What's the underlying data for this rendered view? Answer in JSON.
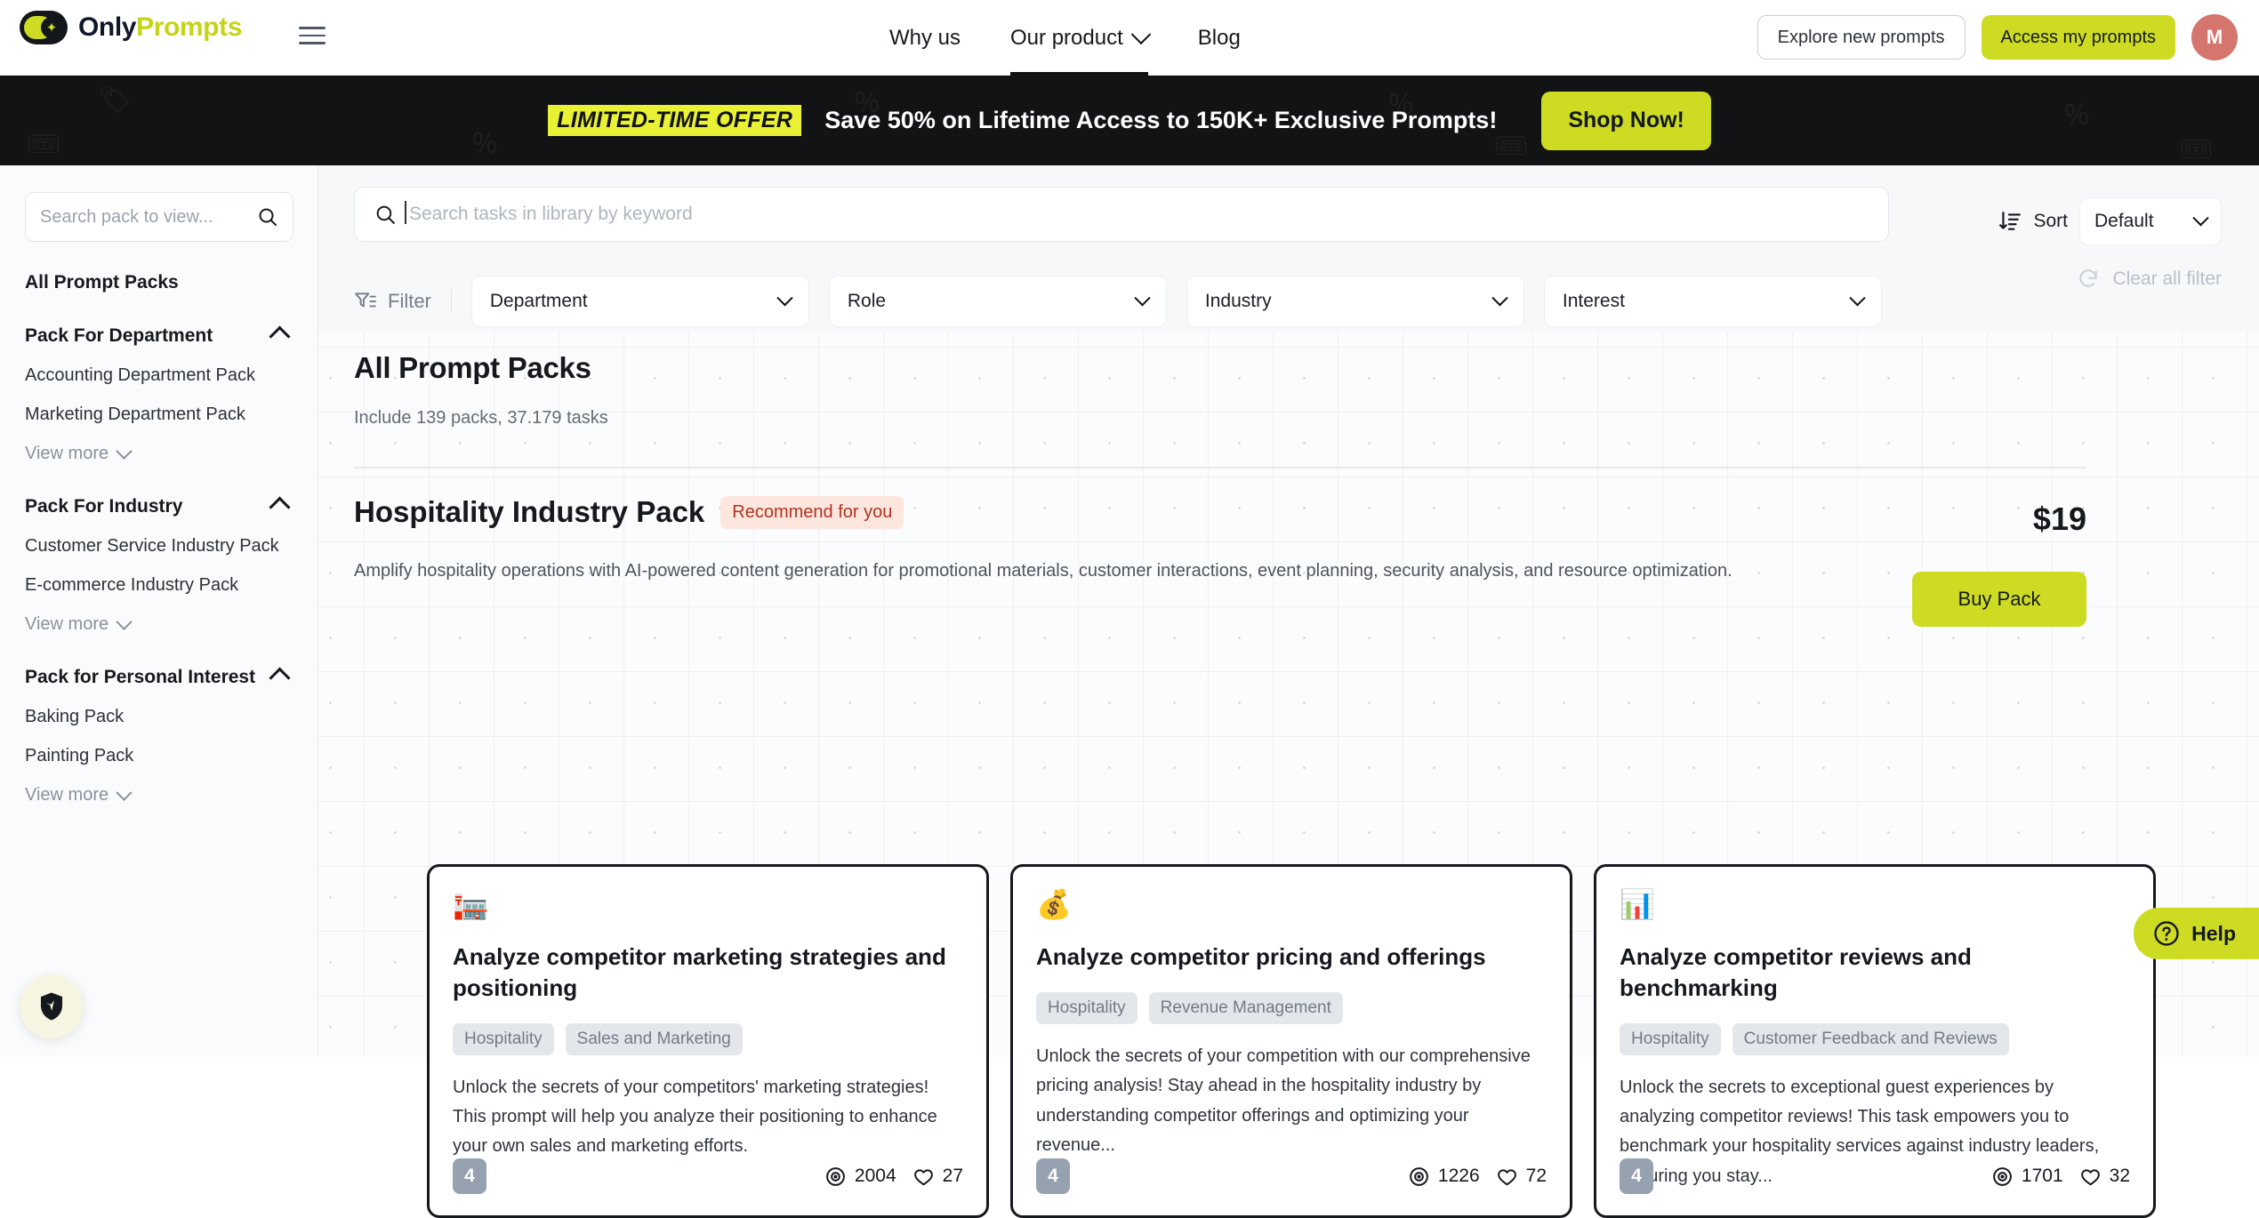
{
  "header": {
    "logo": {
      "name_part1": "Only",
      "name_part2": "Prompts",
      "mark": "toggle-sparkle-logo"
    },
    "menu_icon": "hamburger-icon",
    "nav": [
      {
        "label": "Why us",
        "active": false,
        "has_caret": false
      },
      {
        "label": "Our product",
        "active": true,
        "has_caret": true
      },
      {
        "label": "Blog",
        "active": false,
        "has_caret": false
      }
    ],
    "explore_label": "Explore new prompts",
    "access_label": "Access my prompts",
    "avatar_initial": "M",
    "avatar_color": "#d4756e"
  },
  "promo": {
    "tag": "LIMITED-TIME OFFER",
    "text": "Save 50% on Lifetime Access to 150K+ Exclusive Prompts!",
    "button": "Shop Now!",
    "bg": "#121315",
    "accent": "#cddc22",
    "tag_bg": "#e9f135"
  },
  "sidebar": {
    "search_placeholder": "Search pack to view...",
    "all_packs_label": "All Prompt Packs",
    "view_more_label": "View more",
    "groups": [
      {
        "title": "Pack For Department",
        "items": [
          "Accounting Department Pack",
          "Marketing Department Pack"
        ]
      },
      {
        "title": "Pack For Industry",
        "items": [
          "Customer Service Industry Pack",
          "E-commerce Industry Pack"
        ]
      },
      {
        "title": "Pack for Personal Interest",
        "items": [
          "Baking Pack",
          "Painting Pack"
        ]
      }
    ]
  },
  "toolbar": {
    "search_placeholder": "Search tasks in library by keyword",
    "search_value": "",
    "sort_label": "Sort",
    "sort_value": "Default",
    "filter_label": "Filter",
    "clear_label": "Clear all filter",
    "filters": [
      {
        "label": "Department"
      },
      {
        "label": "Role"
      },
      {
        "label": "Industry"
      },
      {
        "label": "Interest"
      }
    ]
  },
  "page": {
    "title": "All Prompt Packs",
    "subtitle": "Include 139 packs, 37.179 tasks"
  },
  "pack": {
    "title": "Hospitality Industry Pack",
    "badge": "Recommend for you",
    "description": "Amplify hospitality operations with AI-powered content generation for promotional materials, customer interactions, event planning, security analysis, and resource optimization.",
    "price": "$19",
    "buy_label": "Buy Pack"
  },
  "cards": [
    {
      "icon": "🏣",
      "icon_name": "office-building-icon",
      "title": "Analyze competitor marketing strategies and positioning",
      "tags": [
        "Hospitality",
        "Sales and Marketing"
      ],
      "description": "Unlock the secrets of your competitors' marketing strategies! This prompt will help you analyze their positioning to enhance your own sales and marketing efforts.",
      "level": "4",
      "views": "2004",
      "likes": "27"
    },
    {
      "icon": "💰",
      "icon_name": "money-bag-icon",
      "title": "Analyze competitor pricing and offerings",
      "tags": [
        "Hospitality",
        "Revenue Management"
      ],
      "description": "Unlock the secrets of your competition with our comprehensive pricing analysis! Stay ahead in the hospitality industry by understanding competitor offerings and optimizing your revenue...",
      "level": "4",
      "views": "1226",
      "likes": "72"
    },
    {
      "icon": "📊",
      "icon_name": "bar-chart-icon",
      "title": "Analyze competitor reviews and benchmarking",
      "tags": [
        "Hospitality",
        "Customer Feedback and Reviews"
      ],
      "description": "Unlock the secrets to exceptional guest experiences by analyzing competitor reviews! This task empowers you to benchmark your hospitality services against industry leaders, ensuring you stay...",
      "level": "4",
      "views": "1701",
      "likes": "32"
    }
  ],
  "floaters": {
    "help_label": "Help",
    "help_icon": "question-circle-icon",
    "privacy_icon": "shield-icon"
  }
}
